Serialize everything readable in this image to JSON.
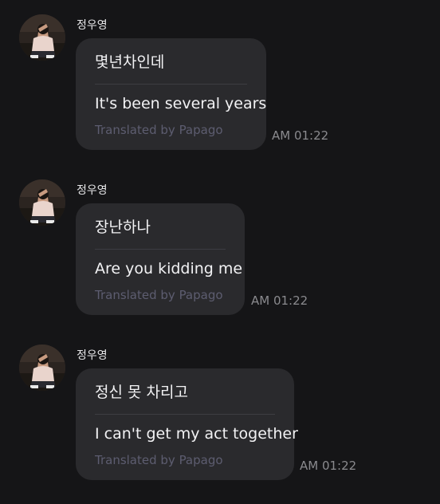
{
  "messages": [
    {
      "sender": "정우영",
      "original": "몇년차인데",
      "translation": "It's been several years",
      "credit": "Translated by Papago",
      "time": "AM 01:22"
    },
    {
      "sender": "정우영",
      "original": "장난하나",
      "translation": "Are you kidding me",
      "credit": "Translated by Papago",
      "time": "AM 01:22"
    },
    {
      "sender": "정우영",
      "original": "정신 못 차리고",
      "translation": "I can't get my act together",
      "credit": "Translated by Papago",
      "time": "AM 01:22"
    }
  ],
  "avatar_icon": "profile-photo",
  "colors": {
    "background": "#151517",
    "bubble": "#2a2a2d",
    "credit_text": "#5d5d70",
    "time_text": "#8a8a8e"
  }
}
